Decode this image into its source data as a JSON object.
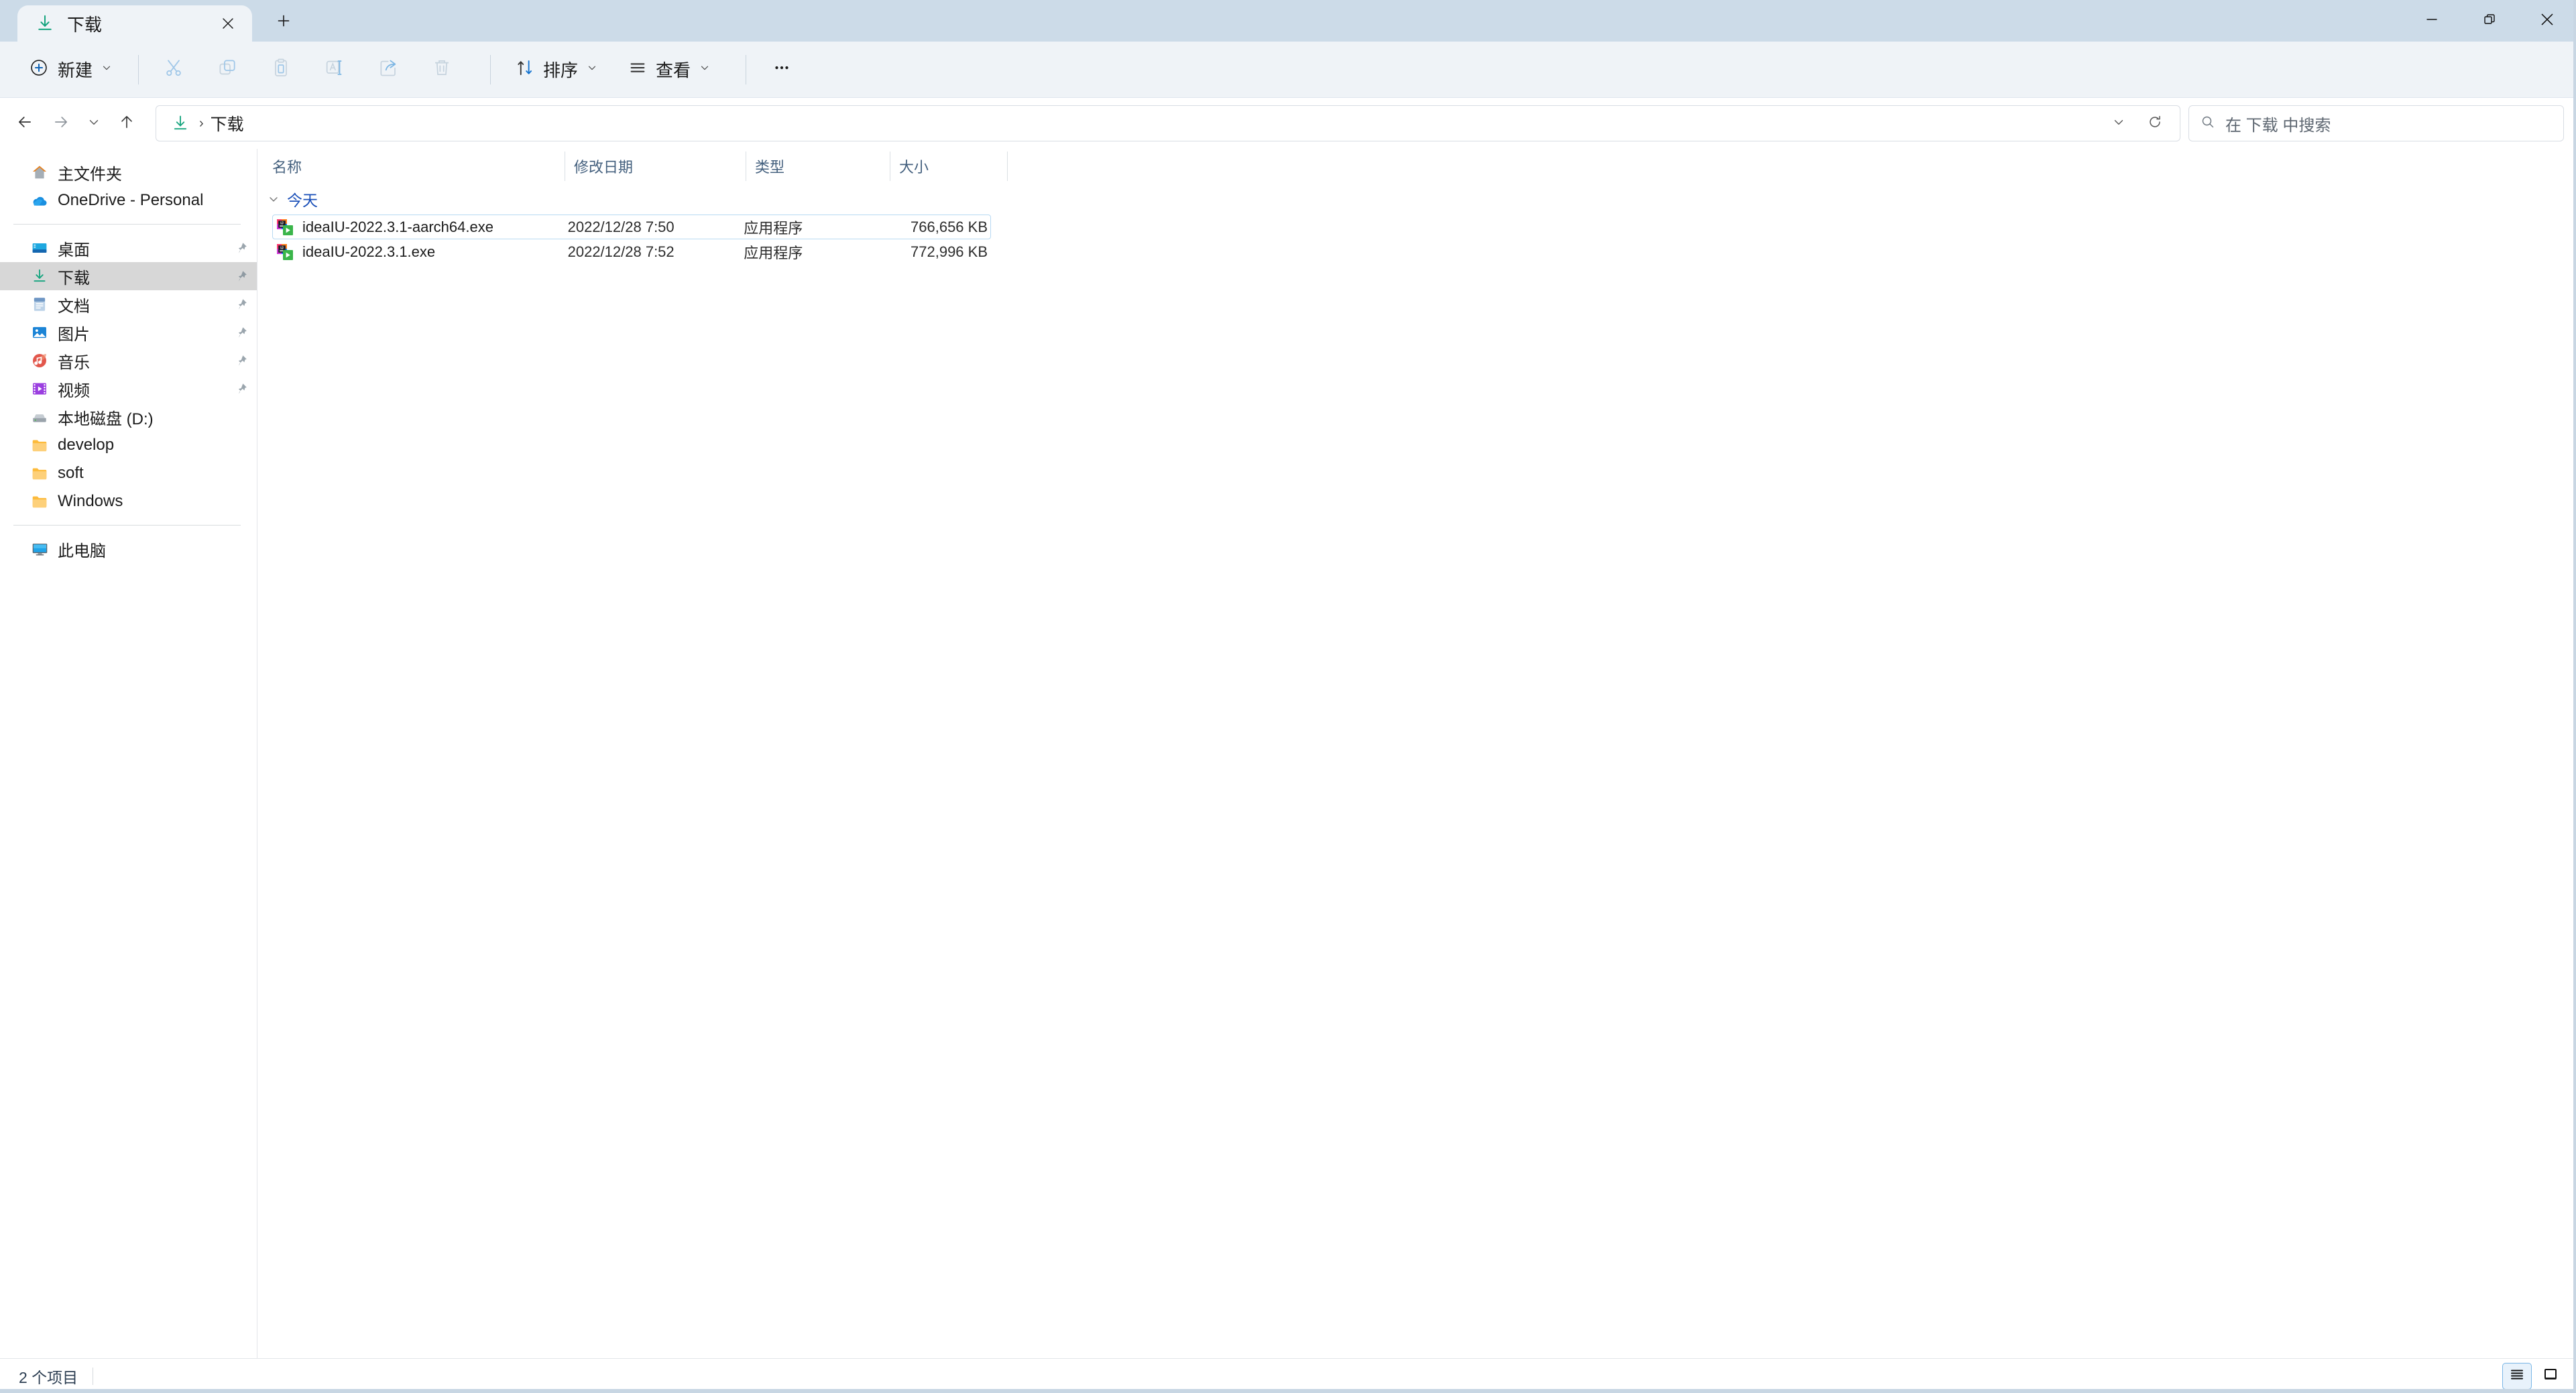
{
  "window": {
    "title": "下载",
    "controls": {
      "minimize": "minimize-icon",
      "restore": "restore-icon",
      "close": "close-icon"
    }
  },
  "tabs": [
    {
      "label": "下载",
      "icon": "download-icon",
      "active": true
    }
  ],
  "newtab": {
    "label": "+",
    "icon": "plus-icon"
  },
  "toolbar": {
    "new_label": "新建",
    "new_icon": "plus-circle-icon",
    "items": [
      {
        "name": "cut",
        "icon": "scissors-icon"
      },
      {
        "name": "copy",
        "icon": "copy-icon"
      },
      {
        "name": "paste",
        "icon": "clipboard-icon"
      },
      {
        "name": "rename",
        "icon": "rename-icon"
      },
      {
        "name": "share",
        "icon": "share-icon"
      },
      {
        "name": "delete",
        "icon": "trash-icon"
      }
    ],
    "sort_label": "排序",
    "sort_icon": "sort-arrows-icon",
    "view_label": "查看",
    "view_icon": "list-lines-icon",
    "more_label": "…",
    "more_icon": "ellipsis-icon"
  },
  "address": {
    "back_icon": "arrow-left-icon",
    "forward_icon": "arrow-right-icon",
    "recent_icon": "chevron-down-icon",
    "up_icon": "arrow-up-icon",
    "crumb_icon": "download-icon",
    "crumb_separator": "›",
    "crumb_text": "下载",
    "dropdown_icon": "chevron-down-icon",
    "refresh_icon": "refresh-icon"
  },
  "search": {
    "icon": "search-icon",
    "placeholder": "在 下载 中搜索",
    "value": ""
  },
  "sidebar": {
    "top": [
      {
        "label": "主文件夹",
        "icon": "home-icon",
        "pinned": false,
        "selected": false
      },
      {
        "label": "OneDrive - Personal",
        "icon": "onedrive-cloud-icon",
        "pinned": false,
        "selected": false
      }
    ],
    "quick": [
      {
        "label": "桌面",
        "icon": "desktop-icon",
        "pinned": true,
        "selected": false
      },
      {
        "label": "下载",
        "icon": "download-icon",
        "pinned": true,
        "selected": true
      },
      {
        "label": "文档",
        "icon": "document-icon",
        "pinned": true,
        "selected": false
      },
      {
        "label": "图片",
        "icon": "pictures-icon",
        "pinned": true,
        "selected": false
      },
      {
        "label": "音乐",
        "icon": "music-icon",
        "pinned": true,
        "selected": false
      },
      {
        "label": "视频",
        "icon": "video-icon",
        "pinned": true,
        "selected": false
      },
      {
        "label": "本地磁盘 (D:)",
        "icon": "harddisk-icon",
        "pinned": false,
        "selected": false
      },
      {
        "label": "develop",
        "icon": "folder-icon",
        "pinned": false,
        "selected": false
      },
      {
        "label": "soft",
        "icon": "folder-icon",
        "pinned": false,
        "selected": false
      },
      {
        "label": "Windows",
        "icon": "folder-icon",
        "pinned": false,
        "selected": false
      }
    ],
    "bottom": [
      {
        "label": "此电脑",
        "icon": "this-pc-icon",
        "pinned": false,
        "selected": false
      }
    ]
  },
  "filelist": {
    "columns": [
      {
        "key": "name",
        "label": "名称",
        "sorted": false
      },
      {
        "key": "date",
        "label": "修改日期",
        "sorted": true
      },
      {
        "key": "type",
        "label": "类型",
        "sorted": false
      },
      {
        "key": "size",
        "label": "大小",
        "sorted": false
      }
    ],
    "groups": [
      {
        "label": "今天",
        "expanded": true,
        "rows": [
          {
            "name": "ideaIU-2022.3.1-aarch64.exe",
            "date": "2022/12/28 7:50",
            "type": "应用程序",
            "size": "766,656 KB",
            "icon": "intellij-installer-icon",
            "focused": true
          },
          {
            "name": "ideaIU-2022.3.1.exe",
            "date": "2022/12/28 7:52",
            "type": "应用程序",
            "size": "772,996 KB",
            "icon": "intellij-installer-icon",
            "focused": false
          }
        ]
      }
    ]
  },
  "statusbar": {
    "item_count": "2 个项目",
    "views": [
      {
        "name": "details-view",
        "icon": "details-list-icon",
        "active": true
      },
      {
        "name": "large-icons-view",
        "icon": "large-icon-tile-icon",
        "active": false
      }
    ]
  },
  "colors": {
    "titlebar": "#ccdbe8",
    "toolbar": "#eff3f7",
    "accent": "#0f6cbd",
    "group_label": "#1a4fb8",
    "column_header": "#44607e",
    "selected_sidebar": "#d7d7d7",
    "focus_outline": "#b7d9f2"
  }
}
